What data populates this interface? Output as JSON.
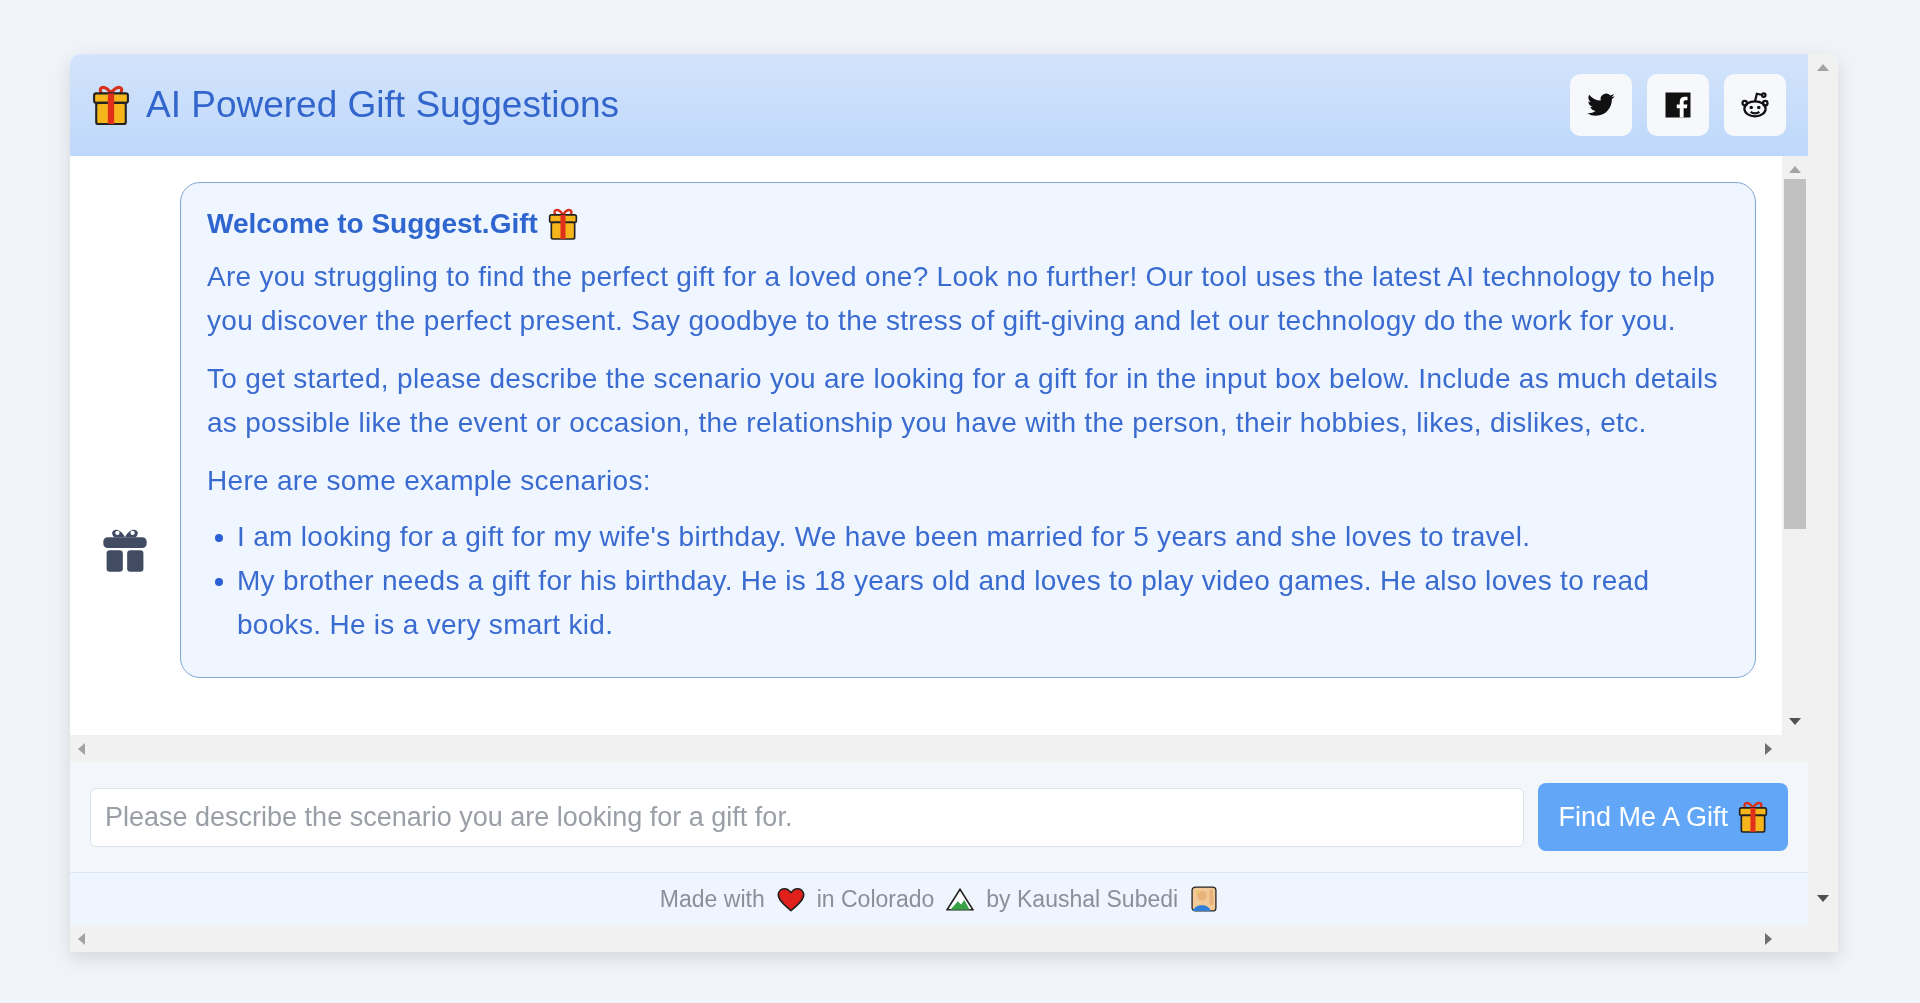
{
  "header": {
    "title": "AI Powered Gift Suggestions",
    "share_buttons": [
      {
        "kind": "bird"
      },
      {
        "kind": "f"
      },
      {
        "kind": "alien"
      }
    ]
  },
  "message": {
    "title": "Welcome to Suggest.Gift",
    "paragraphs": [
      "Are you struggling to find the perfect gift for a loved one? Look no further! Our tool uses the latest AI technology to help you discover the perfect present. Say goodbye to the stress of gift-giving and let our technology do the work for you.",
      "To get started, please describe the scenario you are looking for a gift for in the input box below. Include as much details as possible like the event or occasion, the relationship you have with the person, their hobbies, likes, dislikes, etc.",
      "Here are some example scenarios:"
    ],
    "examples": [
      "I am looking for a gift for my wife's birthday. We have been married for 5 years and she loves to travel.",
      "My brother needs a gift for his birthday. He is 18 years old and loves to play video games. He also loves to read books. He is a very smart kid."
    ]
  },
  "input": {
    "placeholder": "Please describe the scenario you are looking for a gift for.",
    "button": "Find Me A Gift"
  },
  "footer": {
    "parts": [
      {
        "kind": "text",
        "text": "Made with"
      },
      {
        "kind": "heart"
      },
      {
        "kind": "text",
        "text": "in Colorado"
      },
      {
        "kind": "mountain"
      },
      {
        "kind": "text",
        "text": "by Kaushal Subedi"
      },
      {
        "kind": "person"
      }
    ]
  }
}
